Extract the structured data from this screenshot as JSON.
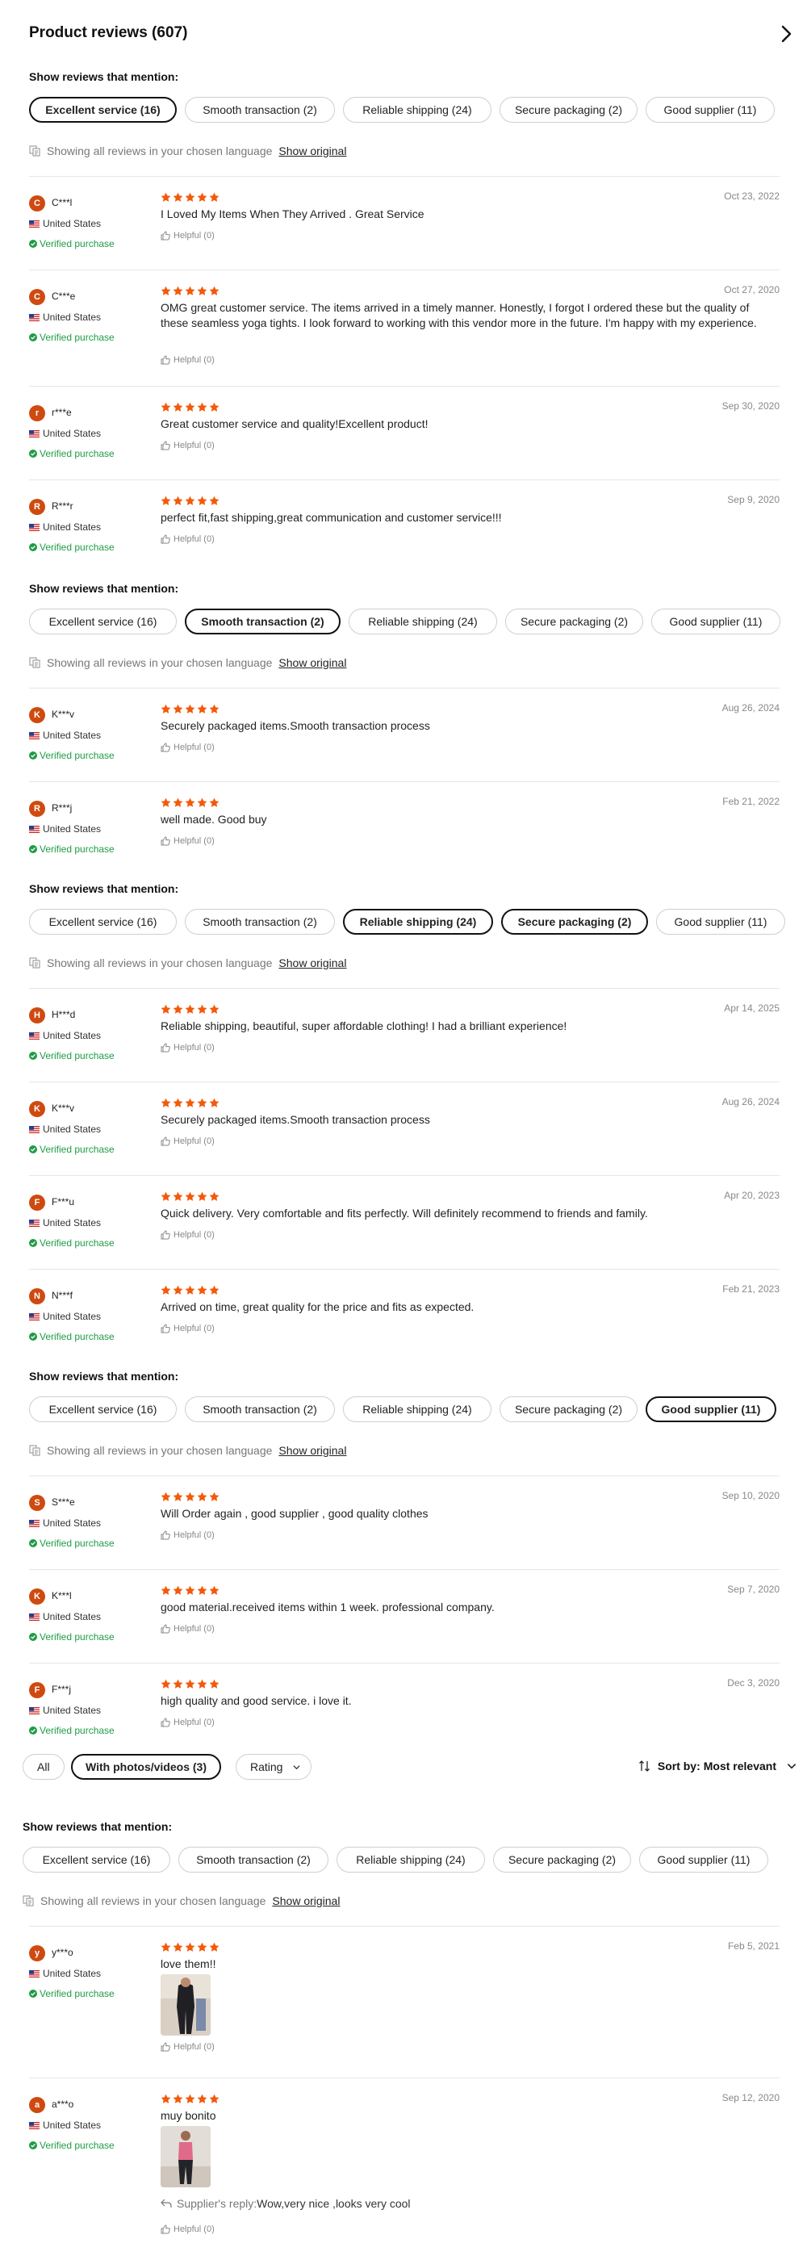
{
  "header": {
    "title": "Product reviews (607)"
  },
  "mention_label": "Show reviews that mention:",
  "language_note": {
    "text": "Showing all reviews in your chosen language",
    "link": "Show original"
  },
  "helpful_label": "Helpful (0)",
  "verified_label": "Verified purchase",
  "country_label": "United States",
  "supplier_reply_label": "Supplier's reply:",
  "mention_sections": [
    {
      "pills": [
        "Excellent service (16)",
        "Smooth transaction (2)",
        "Reliable shipping (24)",
        "Secure packaging (2)",
        "Good supplier (11)"
      ],
      "selected": [
        0
      ]
    },
    {
      "pills": [
        "Excellent service (16)",
        "Smooth transaction (2)",
        "Reliable shipping (24)",
        "Secure packaging (2)",
        "Good supplier (11)"
      ],
      "selected": [
        1
      ]
    },
    {
      "pills": [
        "Excellent service (16)",
        "Smooth transaction (2)",
        "Reliable shipping (24)",
        "Secure packaging (2)",
        "Good supplier (11)"
      ],
      "selected": [
        2,
        3
      ]
    },
    {
      "pills": [
        "Excellent service (16)",
        "Smooth transaction (2)",
        "Reliable shipping (24)",
        "Secure packaging (2)",
        "Good supplier (11)"
      ],
      "selected": [
        4
      ]
    },
    {
      "pills": [
        "Excellent service (16)",
        "Smooth transaction (2)",
        "Reliable shipping (24)",
        "Secure packaging (2)",
        "Good supplier (11)"
      ],
      "selected": []
    }
  ],
  "reviews": [
    {
      "initial": "C",
      "name": "C***l",
      "date": "Oct 23, 2022",
      "rating": 5,
      "text": "I Loved My Items When They Arrived . Great Service"
    },
    {
      "initial": "C",
      "name": "C***e",
      "date": "Oct 27, 2020",
      "rating": 5,
      "text": "OMG great customer service. The items arrived in a timely manner. Honestly, I forgot I ordered these but the quality of these seamless yoga tights. I look forward to working with this vendor more in the future. I'm happy with my experience."
    },
    {
      "initial": "r",
      "name": "r***e",
      "date": "Sep 30, 2020",
      "rating": 5,
      "text": "Great customer service and quality!Excellent product!"
    },
    {
      "initial": "R",
      "name": "R***r",
      "date": "Sep 9, 2020",
      "rating": 5,
      "text": "perfect fit,fast shipping,great communication and customer service!!!"
    },
    {
      "initial": "K",
      "name": "K***v",
      "date": "Aug 26, 2024",
      "rating": 5,
      "text": "Securely packaged items.Smooth transaction process"
    },
    {
      "initial": "R",
      "name": "R***j",
      "date": "Feb 21, 2022",
      "rating": 5,
      "text": "well made. Good buy"
    },
    {
      "initial": "H",
      "name": "H***d",
      "date": "Apr 14, 2025",
      "rating": 5,
      "text": "Reliable shipping, beautiful, super affordable clothing! I had a brilliant experience!"
    },
    {
      "initial": "K",
      "name": "K***v",
      "date": "Aug 26, 2024",
      "rating": 5,
      "text": "Securely packaged items.Smooth transaction process"
    },
    {
      "initial": "F",
      "name": "F***u",
      "date": "Apr 20, 2023",
      "rating": 5,
      "text": "Quick delivery. Very comfortable and fits perfectly. Will definitely recommend to friends and family."
    },
    {
      "initial": "N",
      "name": "N***f",
      "date": "Feb 21, 2023",
      "rating": 5,
      "text": "Arrived on time, great quality for the price and fits as expected."
    },
    {
      "initial": "S",
      "name": "S***e",
      "date": "Sep 10, 2020",
      "rating": 5,
      "text": "Will Order again , good supplier , good quality clothes"
    },
    {
      "initial": "K",
      "name": "K***l",
      "date": "Sep 7, 2020",
      "rating": 5,
      "text": "good material.received items within 1 week. professional company."
    },
    {
      "initial": "F",
      "name": "F***j",
      "date": "Dec 3, 2020",
      "rating": 5,
      "text": "high quality and good service. i love it."
    },
    {
      "initial": "y",
      "name": "y***o",
      "date": "Feb 5, 2021",
      "rating": 5,
      "text": "love them!!"
    },
    {
      "initial": "a",
      "name": "a***o",
      "date": "Sep 12, 2020",
      "rating": 5,
      "text": "muy bonito",
      "reply": "Wow,very nice ,looks very cool"
    }
  ],
  "filter_bar": {
    "all": "All",
    "photos": "With photos/videos (3)",
    "rating": "Rating",
    "sort_label": "Sort by:",
    "sort_value": "Most relevant"
  },
  "colors": {
    "star": "#f25a0a",
    "avatar": "#cf4a10",
    "verified": "#1f9c45"
  }
}
